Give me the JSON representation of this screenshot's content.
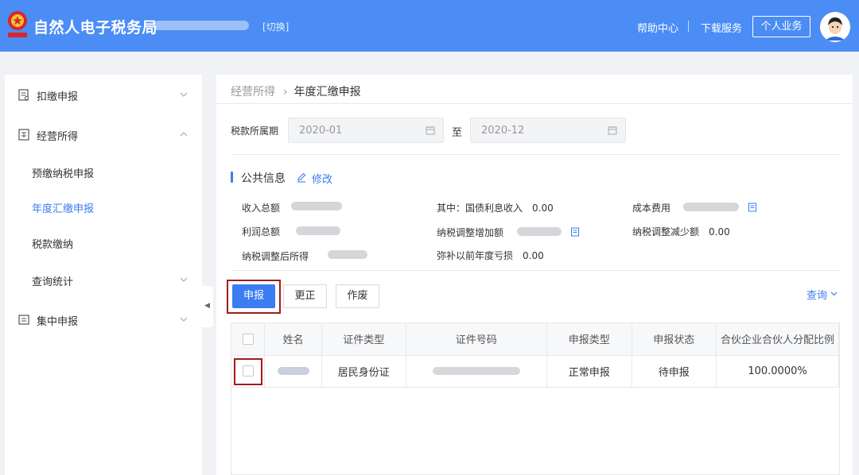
{
  "header": {
    "app_title": "自然人电子税务局",
    "switch_label": "[切换]",
    "help_label": "帮助中心",
    "download_label": "下载服务",
    "personal_label": "个人业务",
    "bg_color": "#4b8df5"
  },
  "sidebar": {
    "items": [
      {
        "label": "扣缴申报",
        "icon": "document-icon"
      },
      {
        "label": "经营所得",
        "icon": "document-icon"
      },
      {
        "label": "预缴纳税申报"
      },
      {
        "label": "年度汇缴申报",
        "active": true
      },
      {
        "label": "税款缴纳"
      },
      {
        "label": "查询统计"
      },
      {
        "label": "集中申报",
        "icon": "document-icon"
      }
    ]
  },
  "breadcrumb": {
    "parent": "经营所得",
    "current": "年度汇缴申报"
  },
  "period": {
    "label": "税款所属期",
    "start": "2020-01",
    "to_label": "至",
    "end": "2020-12"
  },
  "public_info": {
    "title": "公共信息",
    "edit_label": "修改",
    "total_income_label": "收入总额",
    "bond_interest_label": "其中：国债利息收入",
    "bond_interest_value": "0.00",
    "cost_label": "成本费用",
    "total_profit_label": "利润总额",
    "tax_adj_increase_label": "纳税调整增加额",
    "tax_adj_decrease_label": "纳税调整减少额",
    "tax_adj_decrease_value": "0.00",
    "adjusted_income_label": "纳税调整后所得",
    "prior_loss_label": "弥补以前年度亏损",
    "prior_loss_value": "0.00"
  },
  "actions": {
    "declare_label": "申报",
    "correct_label": "更正",
    "void_label": "作废",
    "query_label": "查询",
    "accent_color": "#3b7cf0",
    "highlight_color": "#a31c1c"
  },
  "table": {
    "columns": [
      "姓名",
      "证件类型",
      "证件号码",
      "申报类型",
      "申报状态",
      "合伙企业合伙人分配比例"
    ],
    "rows": [
      {
        "id_type": "居民身份证",
        "declare_type": "正常申报",
        "declare_status": "待申报",
        "ratio": "100.0000%"
      }
    ]
  }
}
